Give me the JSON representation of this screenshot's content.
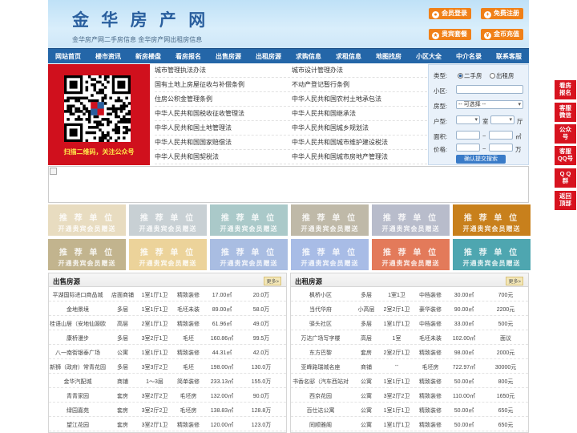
{
  "header": {
    "logo": "金 华 房 产 网",
    "slogan": "金华房产网二手房信息    金华房产网出租房信息",
    "buttons": [
      {
        "icon": "user-icon",
        "label": "会员登录"
      },
      {
        "icon": "register-icon",
        "label": "免费注册"
      },
      {
        "icon": "package-icon",
        "label": "贵宾套餐"
      },
      {
        "icon": "coin-icon",
        "label": "金币充值"
      }
    ]
  },
  "nav": [
    "网站首页",
    "楼市资讯",
    "新房楼盘",
    "看房报名",
    "出售房源",
    "出租房源",
    "求购信息",
    "求租信息",
    "地图找房",
    "小区大全",
    "中介名录",
    "联系客服"
  ],
  "qr": {
    "caption": "扫描二维码，关注公众号"
  },
  "links": {
    "left": [
      "城市管理执法办法",
      "国有土地上房屋征收与补偿条例",
      "住房公积金管理条例",
      "中华人民共和国税收征收管理法",
      "中华人民共和国土地管理法",
      "中华人民共和国国家赔偿法",
      "中华人民共和国契税法"
    ],
    "right": [
      "城市设计管理办法",
      "不动产登记暂行条例",
      "中华人民共和国农村土地承包法",
      "中华人民共和国继承法",
      "中华人民共和国城乡规划法",
      "中华人民共和国城市维护建设税法",
      "中华人民共和国城市房地产管理法"
    ]
  },
  "search": {
    "type_label": "类型:",
    "type_options": [
      "二手房",
      "出租房"
    ],
    "community_label": "小区:",
    "house_type_label": "房型:",
    "house_type_value": "-- 可选择 --",
    "layout_label": "户型:",
    "room_unit": "室",
    "hall_unit": "厅",
    "area_label": "面积:",
    "area_unit": "㎡",
    "price_label": "价格:",
    "price_unit": "万",
    "range_sep": "~",
    "submit": "确认提交搜索"
  },
  "tiles": {
    "title": "推 荐 单 位",
    "subtitle": "开通贵宾会员赠送",
    "colors": [
      "#e8dcc0",
      "#c8d0d4",
      "#aac9c9",
      "#bfb9a8",
      "#b8bccb",
      "#c8801c",
      "#c2b48e",
      "#ecd39a",
      "#a9bde2",
      "#a8bce6",
      "#e37a5a",
      "#4ea6b0"
    ]
  },
  "sale": {
    "title": "出售房源",
    "more": "更多>",
    "rows": [
      [
        "平湖国际进口商品城",
        "店面商铺",
        "1室1厅1卫",
        "精致装修",
        "17.00㎡",
        "20.0万"
      ],
      [
        "金地景境",
        "多层",
        "1室1厅1卫",
        "毛坯未装",
        "89.00㎡",
        "58.0万"
      ],
      [
        "桂语山居（安地仙源欧",
        "高层",
        "2室1厅1卫",
        "精致装修",
        "61.96㎡",
        "49.0万"
      ],
      [
        "康桥漫步",
        "多层",
        "3室2厅1卫",
        "毛坯",
        "160.86㎡",
        "99.5万"
      ],
      [
        "八一南街银泰广场",
        "公寓",
        "1室1厅1卫",
        "精致装修",
        "44.31㎡",
        "42.0万"
      ],
      [
        "新狮（政府）常青花园",
        "多层",
        "3室3厅2卫",
        "毛坯",
        "198.00㎡",
        "130.0万"
      ],
      [
        "金华汽配城",
        "商铺",
        "1～3层",
        "简单装修",
        "233.13㎡",
        "155.0万"
      ],
      [
        "青青家园",
        "套房",
        "3室2厅2卫",
        "毛坯房",
        "132.00㎡",
        "90.0万"
      ],
      [
        "绿园嘉苑",
        "套房",
        "3室2厅2卫",
        "毛坯房",
        "138.83㎡",
        "128.8万"
      ],
      [
        "望江花园",
        "套房",
        "3室2厅1卫",
        "精致装修",
        "120.00㎡",
        "123.0万"
      ]
    ]
  },
  "rent": {
    "title": "出租房源",
    "more": "更多>",
    "rows": [
      [
        "枫桥小区",
        "多层",
        "1室1卫",
        "中档装修",
        "30.00㎡",
        "700元"
      ],
      [
        "当代华府",
        "小高层",
        "2室2厅1卫",
        "豪华装修",
        "90.00㎡",
        "2200元"
      ],
      [
        "驿头社区",
        "多层",
        "1室1厅1卫",
        "中档装修",
        "33.00㎡",
        "500元"
      ],
      [
        "万达广场写字楼",
        "高层",
        "1室",
        "毛坯未装",
        "102.00㎡",
        "面议"
      ],
      [
        "东方巴黎",
        "套房",
        "2室2厅1卫",
        "精致装修",
        "98.00㎡",
        "2000元"
      ],
      [
        "亚峰路瑞城名座",
        "商铺",
        "--",
        "毛坯房",
        "722.97㎡",
        "30000元"
      ],
      [
        "书香名邸（汽车西站对",
        "公寓",
        "1室1厅1卫",
        "精致装修",
        "50.00㎡",
        "800元"
      ],
      [
        "西京花园",
        "公寓",
        "3室2厅2卫",
        "精致装修",
        "110.00㎡",
        "1650元"
      ],
      [
        "百仕达公寓",
        "公寓",
        "1室1厅1卫",
        "精致装修",
        "50.00㎡",
        "650元"
      ],
      [
        "同顺雅阁",
        "公寓",
        "1室1厅1卫",
        "精致装修",
        "50.00㎡",
        "650元"
      ]
    ]
  },
  "side": [
    [
      "看房",
      "报名"
    ],
    [
      "客服",
      "微信"
    ],
    [
      "公众",
      "号"
    ],
    [
      "客服",
      "QQ号"
    ],
    [
      "Q Q",
      "群"
    ],
    [
      "返回",
      "顶部"
    ]
  ]
}
